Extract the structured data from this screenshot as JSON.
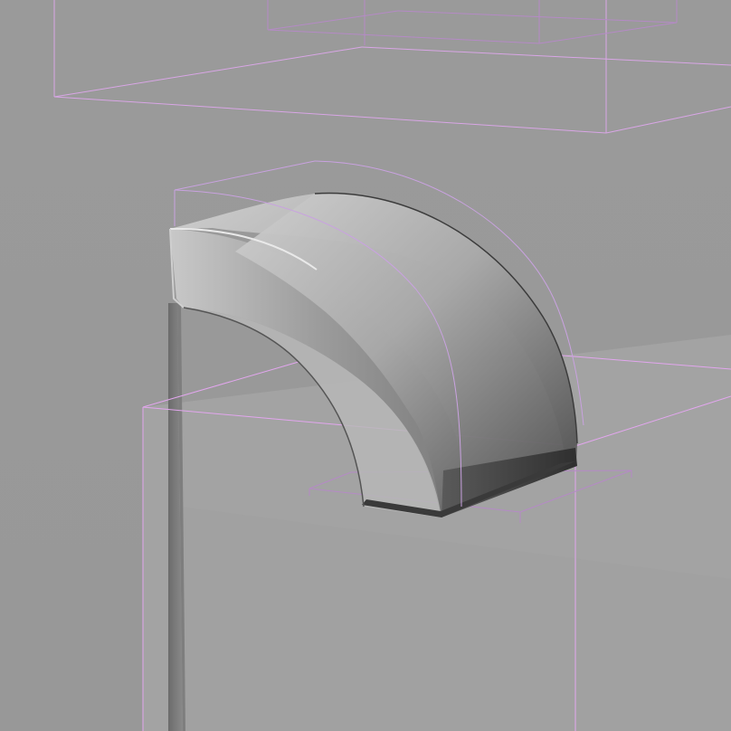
{
  "viewport": {
    "background_color": "#9b9b9b",
    "wire_color": "#d9a6e6",
    "floor_color": "#a6a6a6",
    "floor_dark_color": "#8f8f8f",
    "back_wall_color": "#a2a2a2"
  },
  "objects": [
    {
      "name": "upper-box"
    },
    {
      "name": "small-upper-box"
    },
    {
      "name": "curved-arch"
    },
    {
      "name": "lower-box"
    },
    {
      "name": "base-plane"
    },
    {
      "name": "vertical-panel"
    }
  ]
}
